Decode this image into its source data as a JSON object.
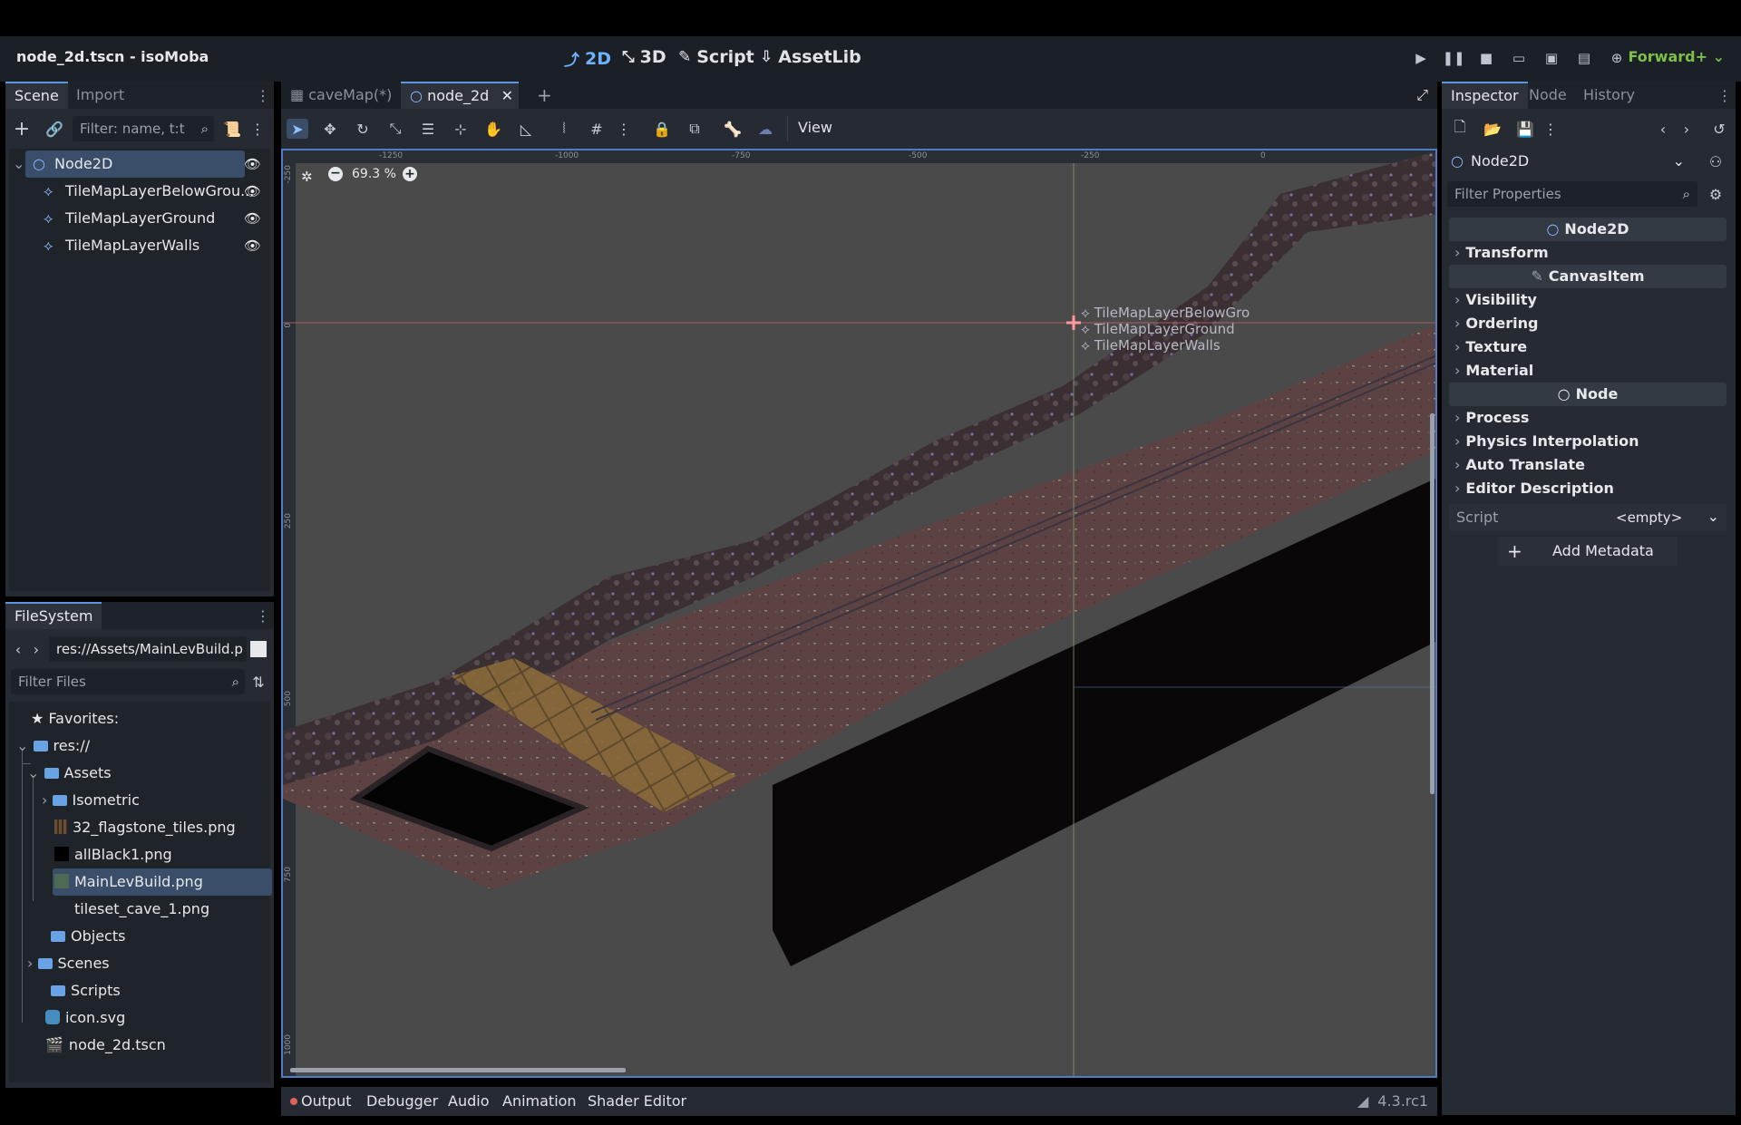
{
  "window": {
    "title": "node_2d.tscn - isoMoba"
  },
  "main_modes": [
    {
      "label": "2D",
      "icon": "2d-icon",
      "active": true
    },
    {
      "label": "3D",
      "icon": "3d-icon",
      "active": false
    },
    {
      "label": "Script",
      "icon": "script-icon",
      "active": false
    },
    {
      "label": "AssetLib",
      "icon": "assetlib-icon",
      "active": false
    }
  ],
  "run_bar": {
    "renderer": "Forward+"
  },
  "left_dock": {
    "tabs": [
      "Scene",
      "Import"
    ],
    "filter_placeholder": "Filter: name, t:t",
    "tree": [
      {
        "label": "Node2D",
        "icon": "node2d-icon",
        "selected": true
      },
      {
        "label": "TileMapLayerBelowGrou...",
        "icon": "tilemap-icon"
      },
      {
        "label": "TileMapLayerGround",
        "icon": "tilemap-icon"
      },
      {
        "label": "TileMapLayerWalls",
        "icon": "tilemap-icon"
      }
    ]
  },
  "filesystem": {
    "tab": "FileSystem",
    "path": "res://Assets/MainLevBuild.p",
    "filter_placeholder": "Filter Files",
    "items": [
      {
        "label": "Favorites:",
        "type": "favorites"
      },
      {
        "label": "res://",
        "type": "folder"
      },
      {
        "label": "Assets",
        "type": "folder"
      },
      {
        "label": "Isometric",
        "type": "folder"
      },
      {
        "label": "32_flagstone_tiles.png",
        "type": "image"
      },
      {
        "label": "allBlack1.png",
        "type": "image"
      },
      {
        "label": "MainLevBuild.png",
        "type": "image",
        "selected": true
      },
      {
        "label": "tileset_cave_1.png",
        "type": "image"
      },
      {
        "label": "Objects",
        "type": "folder"
      },
      {
        "label": "Scenes",
        "type": "folder"
      },
      {
        "label": "Scripts",
        "type": "folder"
      },
      {
        "label": "icon.svg",
        "type": "svg"
      },
      {
        "label": "node_2d.tscn",
        "type": "scene"
      }
    ]
  },
  "editor_tabs": [
    {
      "label": "caveMap(*)",
      "active": false
    },
    {
      "label": "node_2d",
      "active": true
    }
  ],
  "toolbar": {
    "view_label": "View"
  },
  "viewport": {
    "zoom": "69.3 %",
    "ruler_top": [
      "-1250",
      "-1000",
      "-750",
      "-500",
      "-250",
      "0"
    ],
    "ruler_left": [
      "-250",
      "0",
      "250",
      "500",
      "750",
      "1000"
    ],
    "overlay_labels": [
      "TileMapLayerBelowGro",
      "TileMapLayerGround",
      "TileMapLayerWalls"
    ]
  },
  "bottom_panel": {
    "tabs": [
      "Output",
      "Debugger",
      "Audio",
      "Animation",
      "Shader Editor"
    ],
    "version": "4.3.rc1"
  },
  "inspector": {
    "tabs": [
      "Inspector",
      "Node",
      "History"
    ],
    "object": "Node2D",
    "filter_placeholder": "Filter Properties",
    "class_node2d": "Node2D",
    "transform": "Transform",
    "class_canvasitem": "CanvasItem",
    "canvasitem_groups": [
      "Visibility",
      "Ordering",
      "Texture",
      "Material"
    ],
    "class_node": "Node",
    "node_groups": [
      "Process",
      "Physics Interpolation",
      "Auto Translate",
      "Editor Description"
    ],
    "script_label": "Script",
    "script_value": "<empty>",
    "add_metadata": "Add Metadata"
  },
  "colors": {
    "accent": "#5a97e0",
    "renderer": "#7fc04a",
    "selection": "#3a4d69"
  }
}
